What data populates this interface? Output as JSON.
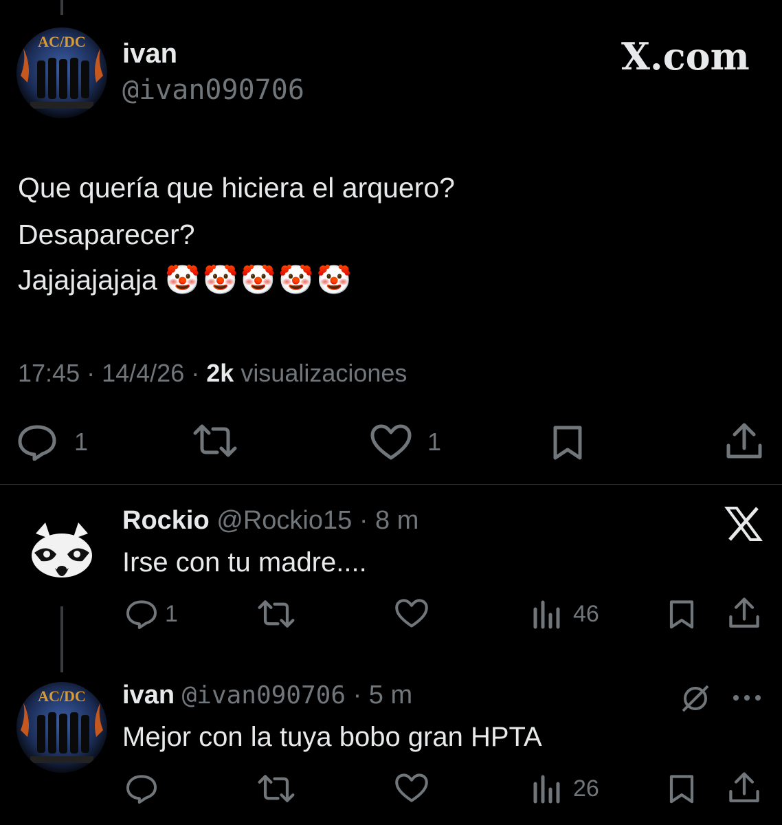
{
  "main_tweet": {
    "name": "ivan",
    "handle": "@ivan090706",
    "brand": "X.com",
    "lines": [
      "Que quería que hiciera el arquero?",
      "Desaparecer?",
      "Jajajajajaja"
    ],
    "emoji": "🤡🤡🤡🤡🤡",
    "time": "17:45",
    "date": "14/4/26",
    "views_count": "2k",
    "views_label": "visualizaciones",
    "replies": "1",
    "likes": "1"
  },
  "reply1": {
    "name": "Rockio",
    "handle": "@Rockio15",
    "time": "· 8 m",
    "text": "Irse con tu madre....",
    "replies": "1",
    "views": "46"
  },
  "reply2": {
    "name": "ivan",
    "handle": "@ivan090706",
    "time": "· 5 m",
    "text": "Mejor con la tuya bobo gran HPTA",
    "views": "26"
  },
  "colors": {
    "background": "#000000",
    "text": "#e7e9ea",
    "muted": "#71767b",
    "divider": "#2f3336"
  }
}
